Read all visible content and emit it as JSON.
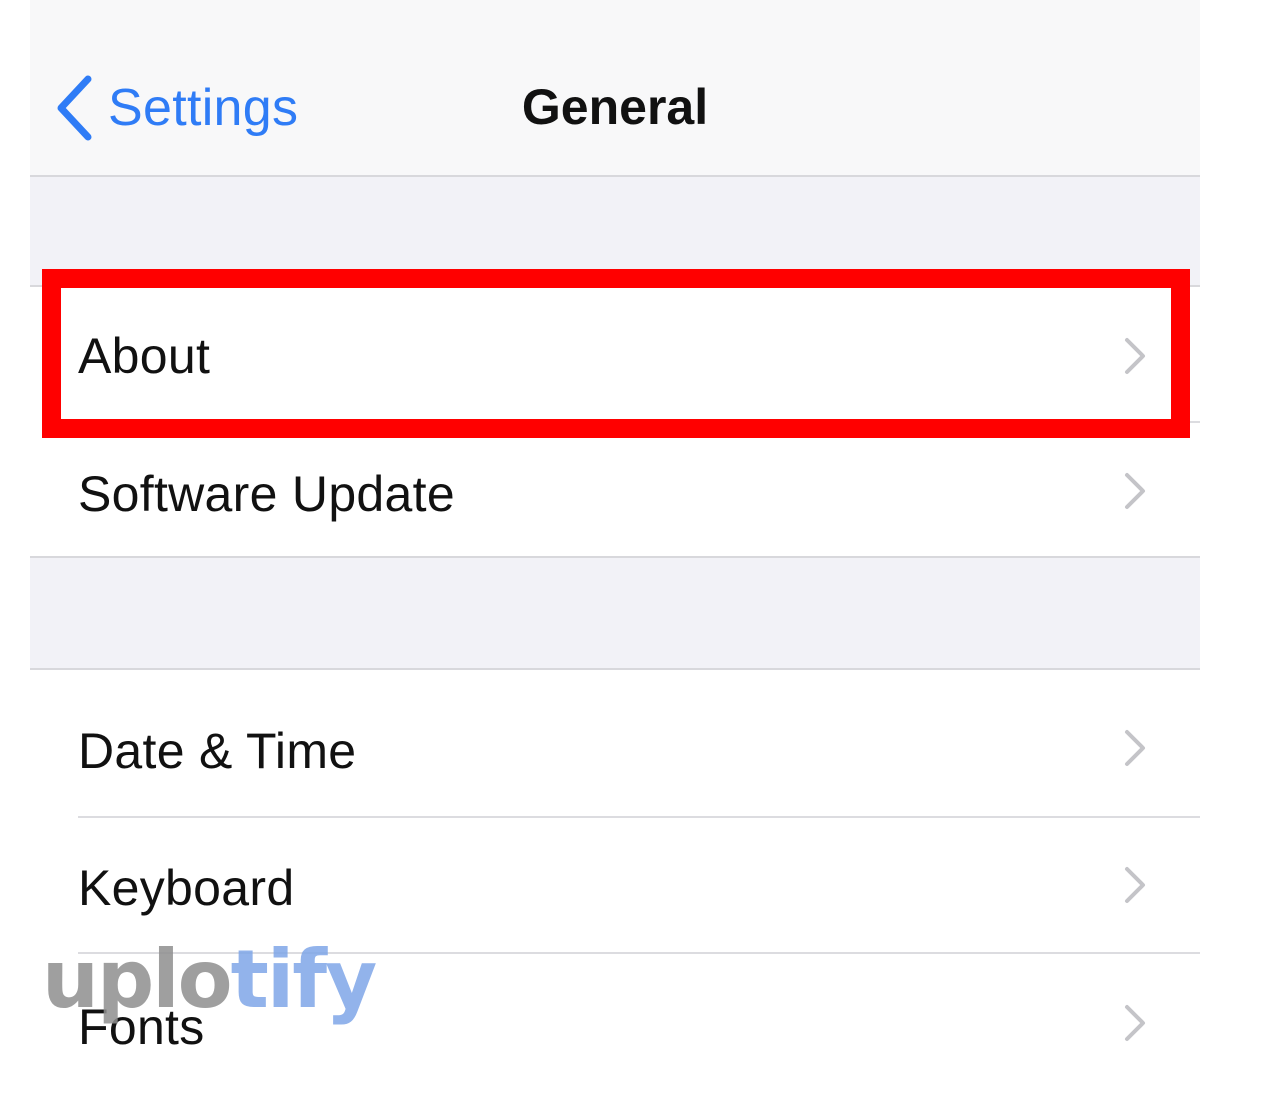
{
  "nav": {
    "back_label": "Settings",
    "title": "General"
  },
  "rows": [
    {
      "label": "About"
    },
    {
      "label": "Software Update"
    },
    {
      "label": "Date & Time"
    },
    {
      "label": "Keyboard"
    },
    {
      "label": "Fonts"
    }
  ],
  "icons": {
    "back": "chevron-left-icon",
    "row_disclosure": "chevron-right-icon"
  },
  "highlighted_row": "About",
  "watermark": {
    "part1": "uplo",
    "part2": "tify"
  },
  "colors": {
    "accent": "#2f7cf6",
    "highlight": "#ff0000",
    "grouped_background": "#f2f2f7",
    "watermark_gray": "#8f8f8f",
    "watermark_blue": "#7fa6e8"
  }
}
